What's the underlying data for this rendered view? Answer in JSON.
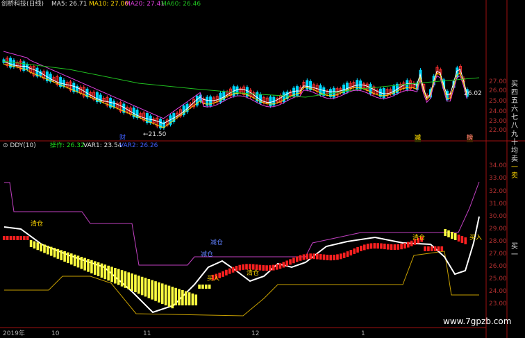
{
  "top_panel": {
    "title": "剑桥科技(日线)",
    "ma5_label": "MA5:",
    "ma5_value": "26.71",
    "ma10_label": "MA10:",
    "ma10_value": "27.00",
    "ma20_label": "MA20:",
    "ma20_value": "27.41",
    "ma60_label": "MA60:",
    "ma60_value": "26.46",
    "y_ticks": [
      "27.00",
      "26.00",
      "25.00",
      "24.00",
      "23.00",
      "22.00"
    ],
    "low_marker": "←21.50",
    "right_marker": "26.02",
    "event_tags": [
      "财",
      "减",
      "榜"
    ]
  },
  "bottom_panel": {
    "title": "DDY(10)",
    "op_label": "操作:",
    "op_value": "26.32",
    "var1_label": "VAR1:",
    "var1_value": "23.54",
    "var2_label": "VAR2:",
    "var2_value": "26.26",
    "y_ticks": [
      "34.00",
      "33.00",
      "32.00",
      "31.00",
      "30.00",
      "29.00",
      "28.00",
      "27.00",
      "26.00",
      "25.00",
      "24.00",
      "23.00"
    ],
    "annotations": [
      "清仓",
      "减仓",
      "减仓",
      "买入",
      "清仓",
      "清仓",
      "买入"
    ]
  },
  "right_side_labels": [
    "买",
    "四",
    "五",
    "六",
    "七",
    "八",
    "九",
    "十",
    "均",
    "卖",
    "一",
    "卖",
    "买",
    "一"
  ],
  "bottom_axis": [
    "2019年",
    "10",
    "11",
    "12",
    "1"
  ],
  "watermark": "www.7gpzb.com",
  "colors": {
    "up": "#ff3030",
    "down": "#00d8ff",
    "ma5": "#ffffff",
    "ma10": "#ffd700",
    "ma20": "#e040e0",
    "ma60": "#20c020",
    "yellow_bar": "#ffff40",
    "red_bar": "#ff2020"
  }
}
